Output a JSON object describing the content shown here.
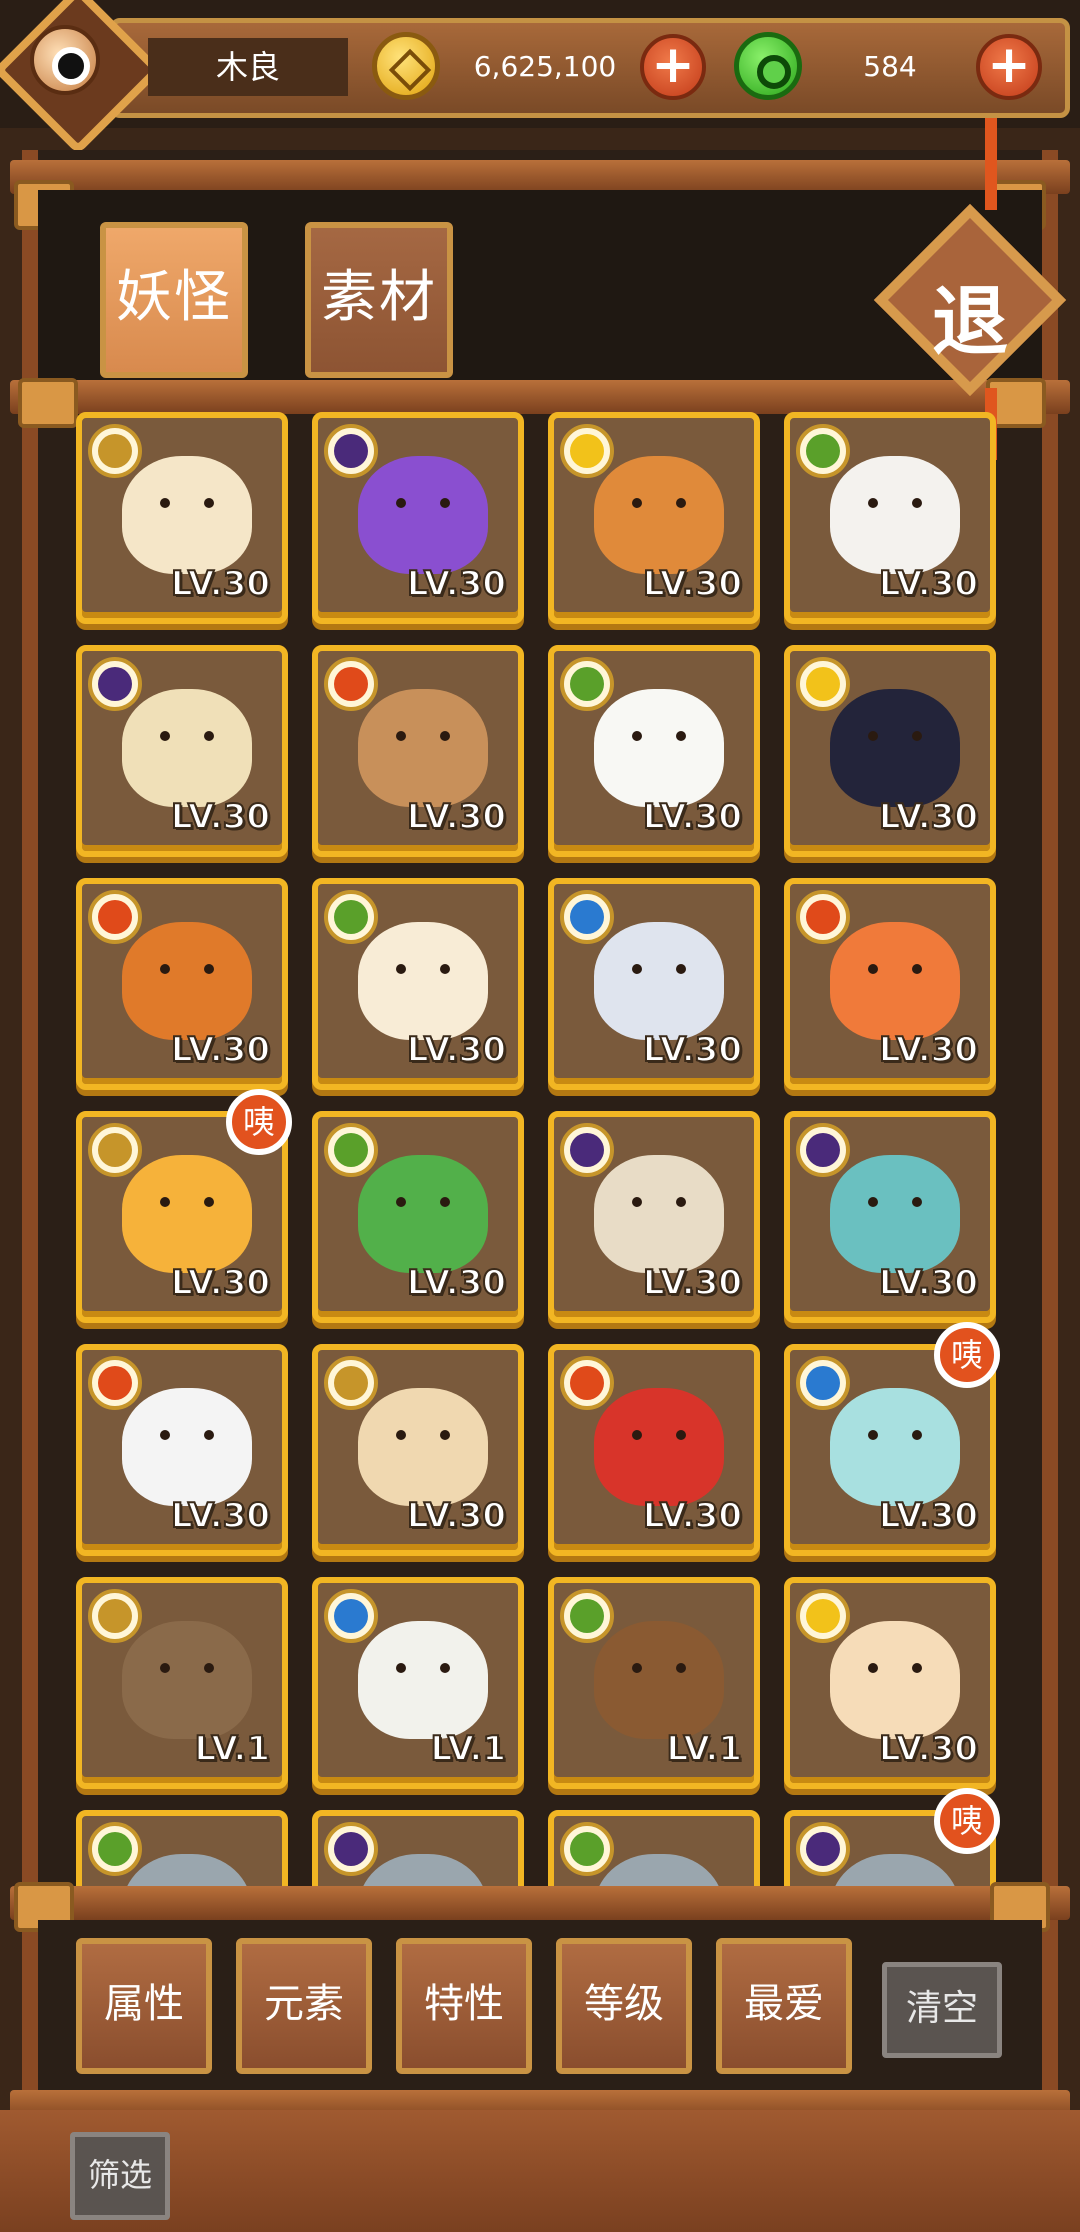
{
  "header": {
    "player_name": "木良",
    "coins": "6,625,100",
    "gems": "584",
    "plus_label": "+"
  },
  "tabs": [
    {
      "label": "妖怪",
      "active": true
    },
    {
      "label": "素材",
      "active": false
    }
  ],
  "exit_label": "退",
  "cards": [
    {
      "element": "mountain",
      "level": "LV.30",
      "color": "#f5e6c8",
      "badge": ""
    },
    {
      "element": "moon",
      "level": "LV.30",
      "color": "#8a4fd0",
      "badge": ""
    },
    {
      "element": "sun",
      "level": "LV.30",
      "color": "#e08a3a",
      "badge": ""
    },
    {
      "element": "leaf",
      "level": "LV.30",
      "color": "#f4f2ee",
      "badge": ""
    },
    {
      "element": "moon",
      "level": "LV.30",
      "color": "#f0e0b8",
      "badge": ""
    },
    {
      "element": "fire",
      "level": "LV.30",
      "color": "#c8905a",
      "badge": ""
    },
    {
      "element": "leaf",
      "level": "LV.30",
      "color": "#f8f8f4",
      "badge": ""
    },
    {
      "element": "sun",
      "level": "LV.30",
      "color": "#23243a",
      "badge": ""
    },
    {
      "element": "fire",
      "level": "LV.30",
      "color": "#e07a2a",
      "badge": ""
    },
    {
      "element": "leaf",
      "level": "LV.30",
      "color": "#f8ecd6",
      "badge": ""
    },
    {
      "element": "water",
      "level": "LV.30",
      "color": "#dfe4ee",
      "badge": ""
    },
    {
      "element": "fire",
      "level": "LV.30",
      "color": "#f07a3a",
      "badge": ""
    },
    {
      "element": "mountain",
      "level": "LV.30",
      "color": "#f6b23a",
      "badge": "咦"
    },
    {
      "element": "leaf",
      "level": "LV.30",
      "color": "#52b04a",
      "badge": ""
    },
    {
      "element": "moon",
      "level": "LV.30",
      "color": "#e8dcc6",
      "badge": ""
    },
    {
      "element": "moon",
      "level": "LV.30",
      "color": "#6ac0c0",
      "badge": ""
    },
    {
      "element": "fire",
      "level": "LV.30",
      "color": "#f4f4f4",
      "badge": ""
    },
    {
      "element": "mountain",
      "level": "LV.30",
      "color": "#f0d8b0",
      "badge": ""
    },
    {
      "element": "fire",
      "level": "LV.30",
      "color": "#d8342a",
      "badge": ""
    },
    {
      "element": "water",
      "level": "LV.30",
      "color": "#a8e0e0",
      "badge": "咦"
    },
    {
      "element": "mountain",
      "level": "LV.1",
      "color": "#8a6a4a",
      "badge": ""
    },
    {
      "element": "water",
      "level": "LV.1",
      "color": "#f2f2ec",
      "badge": ""
    },
    {
      "element": "leaf",
      "level": "LV.1",
      "color": "#8a5a32",
      "badge": ""
    },
    {
      "element": "sun",
      "level": "LV.30",
      "color": "#f6dcb8",
      "badge": ""
    },
    {
      "element": "leaf",
      "level": "",
      "color": "#9aa6ae",
      "badge": ""
    },
    {
      "element": "moon",
      "level": "",
      "color": "#9aa6ae",
      "badge": ""
    },
    {
      "element": "leaf",
      "level": "",
      "color": "#9aa6ae",
      "badge": ""
    },
    {
      "element": "moon",
      "level": "",
      "color": "#9aa6ae",
      "badge": "咦"
    }
  ],
  "element_colors": {
    "mountain": "#c6952a",
    "moon": "#4a2a7a",
    "sun": "#f2c21a",
    "leaf": "#5aa02a",
    "fire": "#e04a1a",
    "water": "#2a7ad0"
  },
  "filters": [
    {
      "label": "属性"
    },
    {
      "label": "元素"
    },
    {
      "label": "特性"
    },
    {
      "label": "等级"
    },
    {
      "label": "最爱"
    }
  ],
  "clear_label": "清空",
  "screen_label": "筛选"
}
